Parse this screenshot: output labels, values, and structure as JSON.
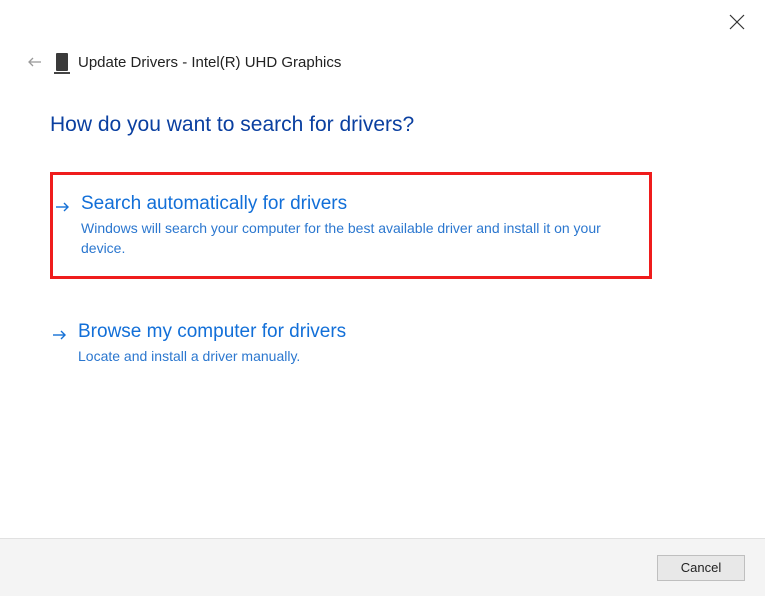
{
  "window": {
    "title": "Update Drivers - Intel(R) UHD Graphics"
  },
  "heading": "How do you want to search for drivers?",
  "options": [
    {
      "title": "Search automatically for drivers",
      "subtitle": "Windows will search your computer for the best available driver and install it on your device.",
      "highlight": true
    },
    {
      "title": "Browse my computer for drivers",
      "subtitle": "Locate and install a driver manually.",
      "highlight": false
    }
  ],
  "footer": {
    "cancel_label": "Cancel"
  },
  "icons": {
    "back": "back-arrow-icon",
    "close": "close-icon",
    "device": "device-icon",
    "option_arrow": "arrow-right-icon"
  }
}
